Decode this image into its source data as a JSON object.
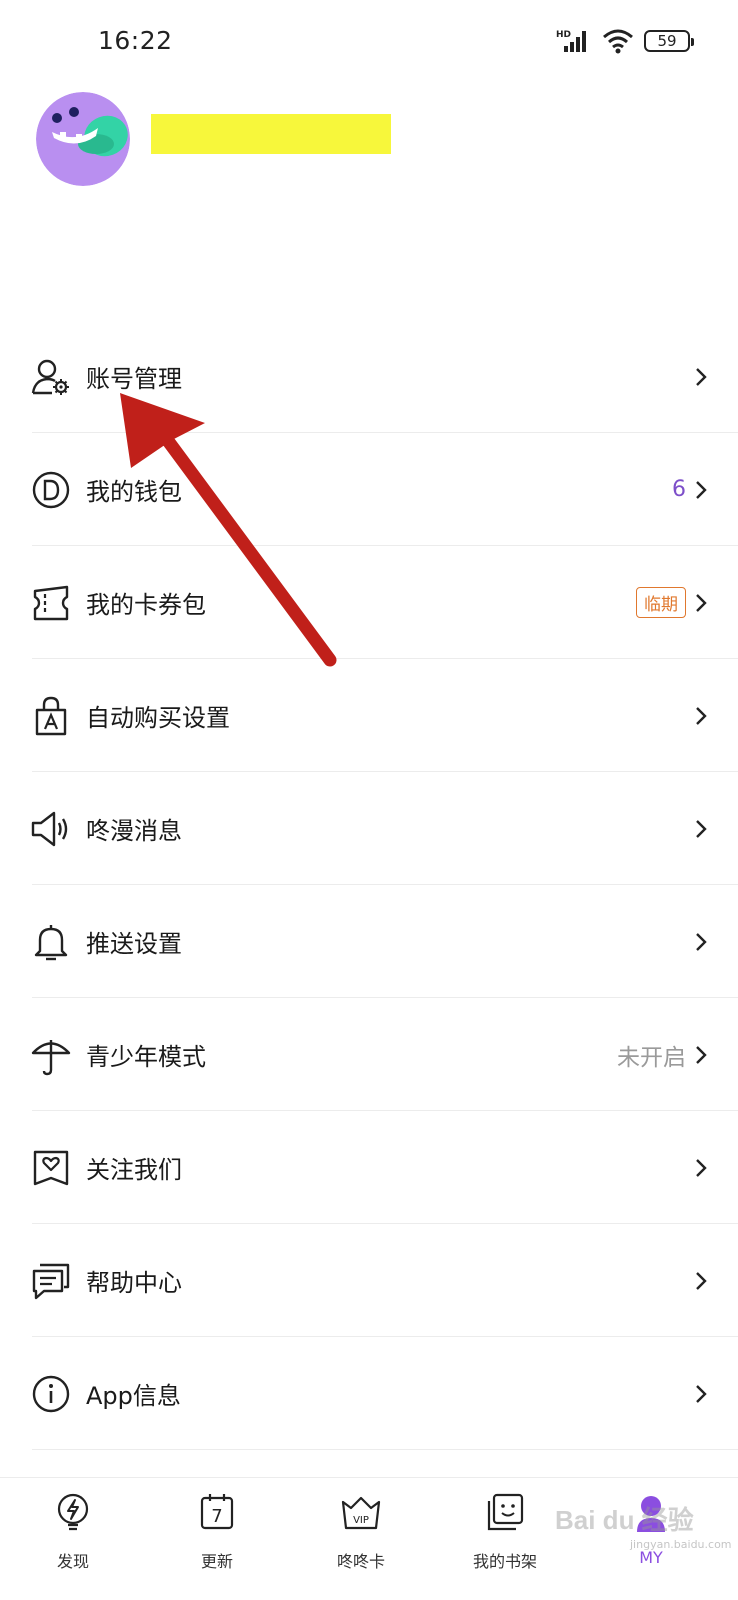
{
  "status_bar": {
    "time": "16:22",
    "network": "HD",
    "battery": "59"
  },
  "profile": {
    "avatar_icon": "monster-avatar-icon"
  },
  "menu": [
    {
      "label": "账号管理",
      "icon": "account-settings-icon",
      "extra": ""
    },
    {
      "label": "我的钱包",
      "icon": "wallet-coin-icon",
      "extra": "6"
    },
    {
      "label": "我的卡券包",
      "icon": "ticket-icon",
      "badge": "临期"
    },
    {
      "label": "自动购买设置",
      "icon": "shopping-bag-icon",
      "extra": ""
    },
    {
      "label": "咚漫消息",
      "icon": "speaker-icon",
      "extra": ""
    },
    {
      "label": "推送设置",
      "icon": "bell-icon",
      "extra": ""
    },
    {
      "label": "青少年模式",
      "icon": "umbrella-icon",
      "extra": "未开启"
    },
    {
      "label": "关注我们",
      "icon": "heart-bookmark-icon",
      "extra": ""
    },
    {
      "label": "帮助中心",
      "icon": "chat-bubble-icon",
      "extra": ""
    },
    {
      "label": "App信息",
      "icon": "info-icon",
      "extra": ""
    }
  ],
  "tabbar": [
    {
      "label": "发现",
      "icon": "lightbulb-icon",
      "active": false
    },
    {
      "label": "更新",
      "icon": "calendar-icon",
      "calendar_day": "7",
      "active": false
    },
    {
      "label": "咚咚卡",
      "icon": "vip-crown-icon",
      "icon_text": "VIP",
      "active": false
    },
    {
      "label": "我的书架",
      "icon": "bookshelf-icon",
      "active": false
    },
    {
      "label": "MY",
      "icon": "profile-icon",
      "active": true
    }
  ],
  "watermark": {
    "text": "Bai du 经验",
    "sub": "jingyan.baidu.com"
  },
  "colors": {
    "accent": "#8b4ee0",
    "badge": "#e0782e",
    "annotation_arrow": "#c0201a",
    "highlight": "#f7f73b"
  }
}
